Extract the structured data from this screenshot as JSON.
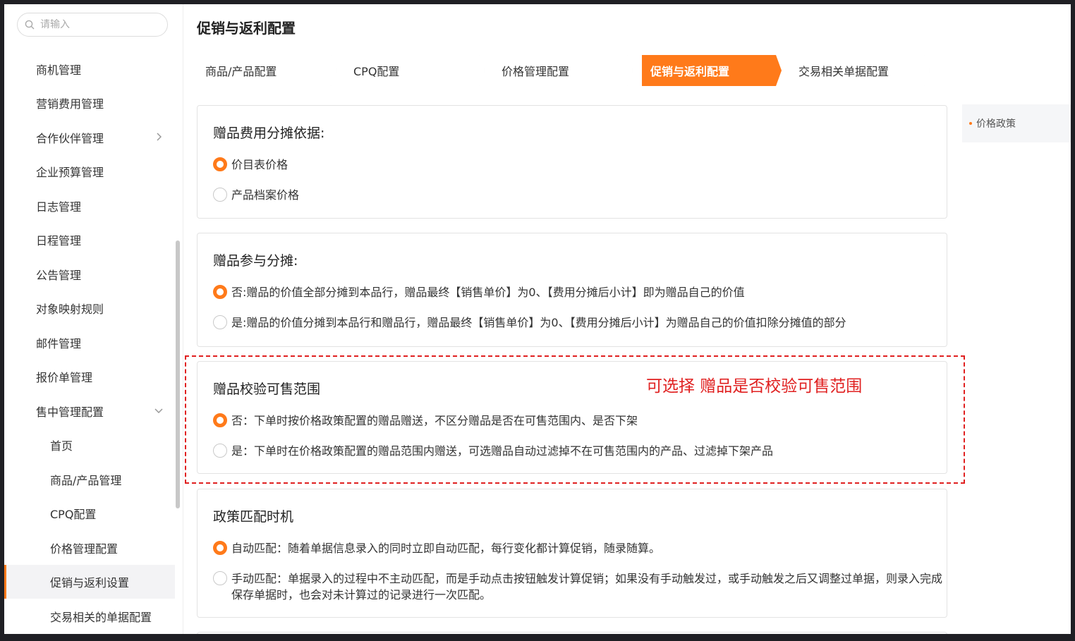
{
  "search": {
    "placeholder": "请输入"
  },
  "sidebar": {
    "items": [
      {
        "label": "商机管理"
      },
      {
        "label": "营销费用管理"
      },
      {
        "label": "合作伙伴管理"
      },
      {
        "label": "企业预算管理"
      },
      {
        "label": "日志管理"
      },
      {
        "label": "日程管理"
      },
      {
        "label": "公告管理"
      },
      {
        "label": "对象映射规则"
      },
      {
        "label": "邮件管理"
      },
      {
        "label": "报价单管理"
      },
      {
        "label": "售中管理配置"
      }
    ],
    "subitems": [
      {
        "label": "首页"
      },
      {
        "label": "商品/产品管理"
      },
      {
        "label": "CPQ配置"
      },
      {
        "label": "价格管理配置"
      },
      {
        "label": "促销与返利设置"
      },
      {
        "label": "交易相关的单据配置"
      }
    ]
  },
  "page_title": "促销与返利配置",
  "tabs": [
    {
      "label": "商品/产品配置"
    },
    {
      "label": "CPQ配置"
    },
    {
      "label": "价格管理配置"
    },
    {
      "label": "促销与返利配置"
    },
    {
      "label": "交易相关单据配置"
    }
  ],
  "sections": [
    {
      "title": "赠品费用分摊依据:",
      "options": [
        {
          "text": "价目表价格",
          "selected": true
        },
        {
          "text": "产品档案价格",
          "selected": false
        }
      ]
    },
    {
      "title": "赠品参与分摊:",
      "options": [
        {
          "text": "否:赠品的价值全部分摊到本品行，赠品最终【销售单价】为0、【费用分摊后小计】即为赠品自己的价值",
          "selected": true
        },
        {
          "text": "是:赠品的价值分摊到本品行和赠品行，赠品最终【销售单价】为0、【费用分摊后小计】为赠品自己的价值扣除分摊值的部分",
          "selected": false
        }
      ]
    },
    {
      "title": "赠品校验可售范围",
      "options": [
        {
          "text": "否：下单时按价格政策配置的赠品赠送，不区分赠品是否在可售范围内、是否下架",
          "selected": true
        },
        {
          "text": "是：下单时在价格政策配置的赠品范围内赠送，可选赠品自动过滤掉不在可售范围内的产品、过滤掉下架产品",
          "selected": false
        }
      ]
    },
    {
      "title": "政策匹配时机",
      "options": [
        {
          "text": "自动匹配：随着单据信息录入的同时立即自动匹配，每行变化都计算促销，随录随算。",
          "selected": true
        },
        {
          "text": "手动匹配：单据录入的过程中不主动匹配，而是手动点击按钮触发计算促销；如果没有手动触发过，或手动触发之后又调整过单据，则录入完成保存单据时，也会对未计算过的记录进行一次匹配。",
          "selected": false
        }
      ]
    }
  ],
  "annotation": "可选择 赠品是否校验可售范围",
  "toc": {
    "item": "价格政策"
  },
  "colors": {
    "accent": "#ff7a1a",
    "annotation": "#e02020"
  }
}
